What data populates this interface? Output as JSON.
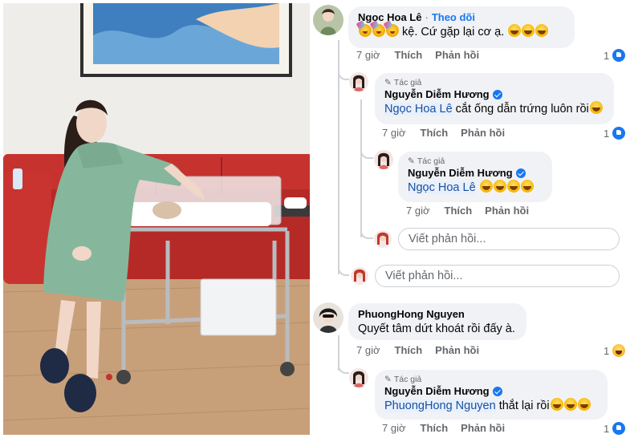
{
  "comments": [
    {
      "author": "Ngọc Hoa Lê",
      "follow_label": "Theo dõi",
      "separator": "·",
      "text": "kệ. Cứ gặp lại cơ ạ.",
      "time": "7 giờ",
      "like_label": "Thích",
      "reply_label": "Phản hồi",
      "reaction_count": "1",
      "reaction_icon": "like-icon"
    },
    {
      "badge": "Tác giả",
      "author": "Nguyễn Diễm Hương",
      "mention": "Ngọc Hoa Lê",
      "text": "cắt ống dẫn trứng luôn rồi",
      "time": "7 giờ",
      "like_label": "Thích",
      "reply_label": "Phản hồi",
      "reaction_count": "1",
      "reaction_icon": "like-icon"
    },
    {
      "badge": "Tác giả",
      "author": "Nguyễn Diễm Hương",
      "mention": "Ngọc Hoa Lê",
      "text": "",
      "time": "7 giờ",
      "like_label": "Thích",
      "reply_label": "Phản hồi"
    },
    {
      "author": "PhuongHong Nguyen",
      "text": "Quyết tâm dứt khoát rồi đấy à.",
      "time": "7 giờ",
      "like_label": "Thích",
      "reply_label": "Phản hồi",
      "reaction_count": "1",
      "reaction_icon": "haha-icon"
    },
    {
      "badge": "Tác giả",
      "author": "Nguyễn Diễm Hương",
      "mention": "PhuongHong Nguyen",
      "text": "thắt lại rồi",
      "time": "7 giờ",
      "like_label": "Thích",
      "reply_label": "Phản hồi",
      "reaction_count": "1",
      "reaction_icon": "like-icon"
    }
  ],
  "reply_placeholder": "Viết phản hồi...",
  "colors": {
    "link": "#1877f2",
    "bubble": "#f0f2f5",
    "meta": "#65676b",
    "mention_bg": "#e7f0fe"
  }
}
